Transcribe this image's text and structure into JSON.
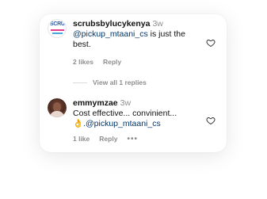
{
  "comments": [
    {
      "username": "scrubsbylucykenya",
      "time": "3w",
      "mention": "@pickup_mtaani_cs",
      "text_after": " is just the best.",
      "likes": "2 likes",
      "reply": "Reply",
      "avatar_text": "SCRUB"
    },
    {
      "username": "emmymzae",
      "time": "3w",
      "text_line1": "Cost effective... convinient...",
      "emoji": "👌",
      "mention": ".@pickup_mtaani_cs",
      "likes": "1 like",
      "reply": "Reply",
      "more": "•••"
    }
  ],
  "view_replies": "View all 1 replies",
  "icons": {
    "like": "heart-outline-icon",
    "more": "more-horizontal-icon"
  },
  "colors": {
    "mention": "#00376b",
    "secondary_text": "#8e8e8e",
    "divider": "#dbdbdb"
  }
}
